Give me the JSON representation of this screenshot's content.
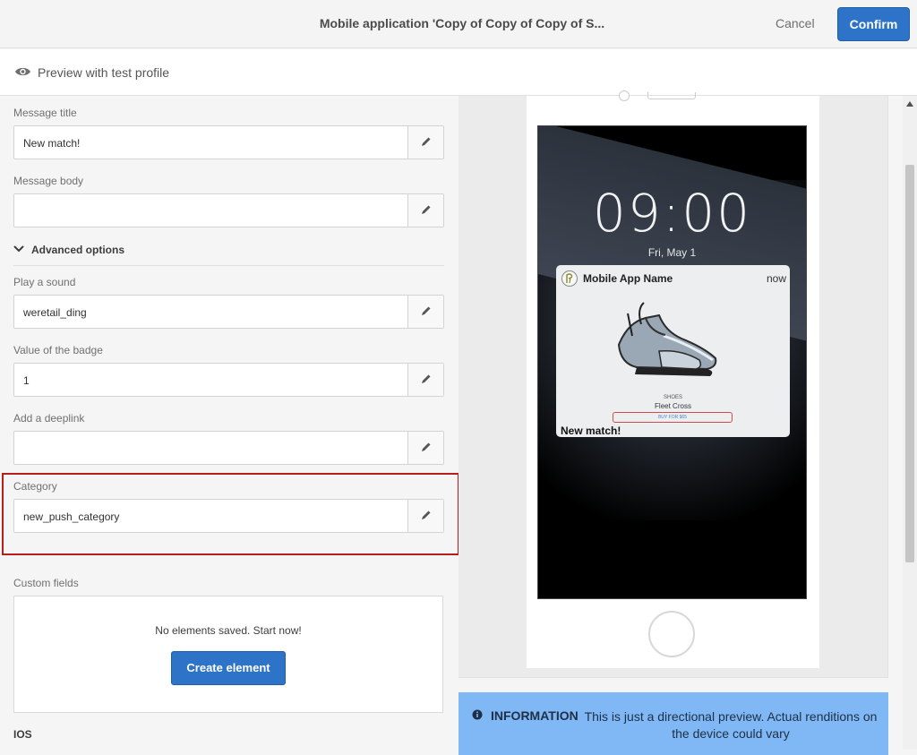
{
  "header": {
    "title": "Mobile application 'Copy of Copy of Copy of S...",
    "cancel_label": "Cancel",
    "confirm_label": "Confirm"
  },
  "preview_bar": {
    "label": "Preview with test profile",
    "icon": "eye-icon"
  },
  "form": {
    "message_title": {
      "label": "Message title",
      "value": "New match!"
    },
    "message_body": {
      "label": "Message body",
      "value": ""
    },
    "advanced_label": "Advanced options",
    "play_sound": {
      "label": "Play a sound",
      "value": "weretail_ding"
    },
    "badge": {
      "label": "Value of the badge",
      "value": "1"
    },
    "deeplink": {
      "label": "Add a deeplink",
      "value": ""
    },
    "category": {
      "label": "Category",
      "value": "new_push_category"
    },
    "custom_fields": {
      "label": "Custom fields",
      "empty_text": "No elements saved. Start now!",
      "create_label": "Create element"
    },
    "ios_label": "IOS",
    "highlight_color": "#b41e1e"
  },
  "preview": {
    "time": "09:00",
    "date": "Fri, May 1",
    "notification": {
      "app_name": "Mobile App Name",
      "timestamp": "now",
      "brand": "SHOES",
      "product": "Fleet Cross",
      "buy_label": "BUY FOR $65",
      "message": "New match!"
    }
  },
  "info": {
    "heading": "INFORMATION",
    "text": "This is just a directional preview. Actual renditions on the device could vary"
  },
  "colors": {
    "primary": "#2d73c8",
    "info_bg": "#7fb8f5"
  }
}
